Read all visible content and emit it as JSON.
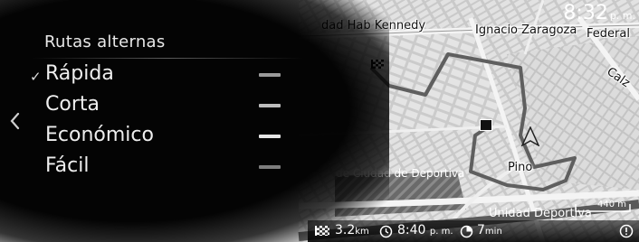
{
  "clock": {
    "time": "8:32",
    "ampm": "p. m."
  },
  "panel": {
    "title": "Rutas alternas",
    "routes": [
      {
        "label": "Rápida",
        "selected": true,
        "check": "✓",
        "color": "#9a9a9a"
      },
      {
        "label": "Corta",
        "selected": false,
        "check": "",
        "color": "#bdbdbd"
      },
      {
        "label": "Económico",
        "selected": false,
        "check": "",
        "color": "#e6e6e6"
      },
      {
        "label": "Fácil",
        "selected": false,
        "check": "",
        "color": "#7d7d7d"
      }
    ],
    "back_icon": "chevron-left-icon"
  },
  "map": {
    "labels": {
      "unidad_hab": "dad Hab Kennedy",
      "ignacio": "Ignacio Zaragoza",
      "federal": "Federal",
      "calz": "Calz",
      "ciudad_deportiva": "de Ciudad de Deportiva",
      "pino": "Pino",
      "unidad_deportiva": "Unidad Deportiva"
    },
    "scale": "440 m"
  },
  "info": {
    "distance_value": "3.2",
    "distance_unit": "km",
    "arrival_time": "8:40",
    "arrival_ampm": "p. m.",
    "duration_value": "7",
    "duration_unit": "min"
  }
}
